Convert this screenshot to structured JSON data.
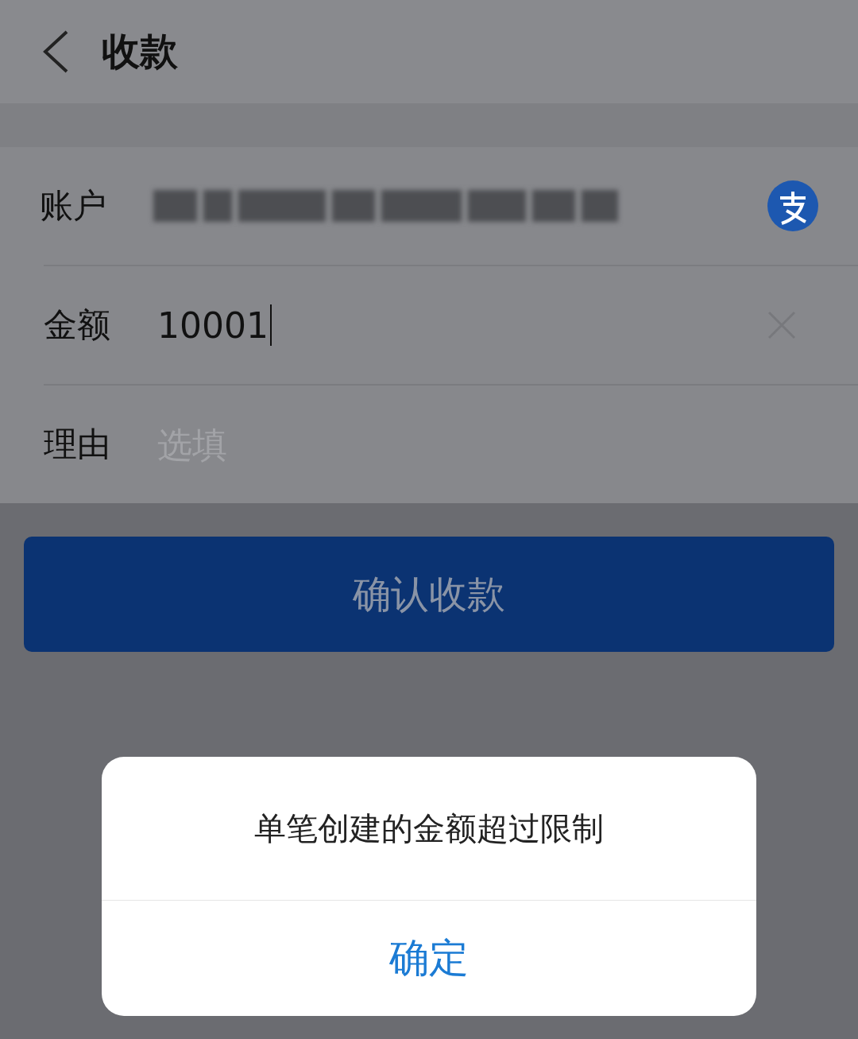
{
  "header": {
    "title": "收款"
  },
  "fields": [
    {
      "kind": "account",
      "label": "账户"
    },
    {
      "kind": "amount",
      "label": "金额",
      "value": "10001"
    },
    {
      "kind": "reason",
      "label": "理由",
      "placeholder": "选填"
    }
  ],
  "confirm_button": {
    "label": "确认收款",
    "disabled": true
  },
  "dialog": {
    "message": "单笔创建的金额超过限制",
    "button": "确定"
  }
}
